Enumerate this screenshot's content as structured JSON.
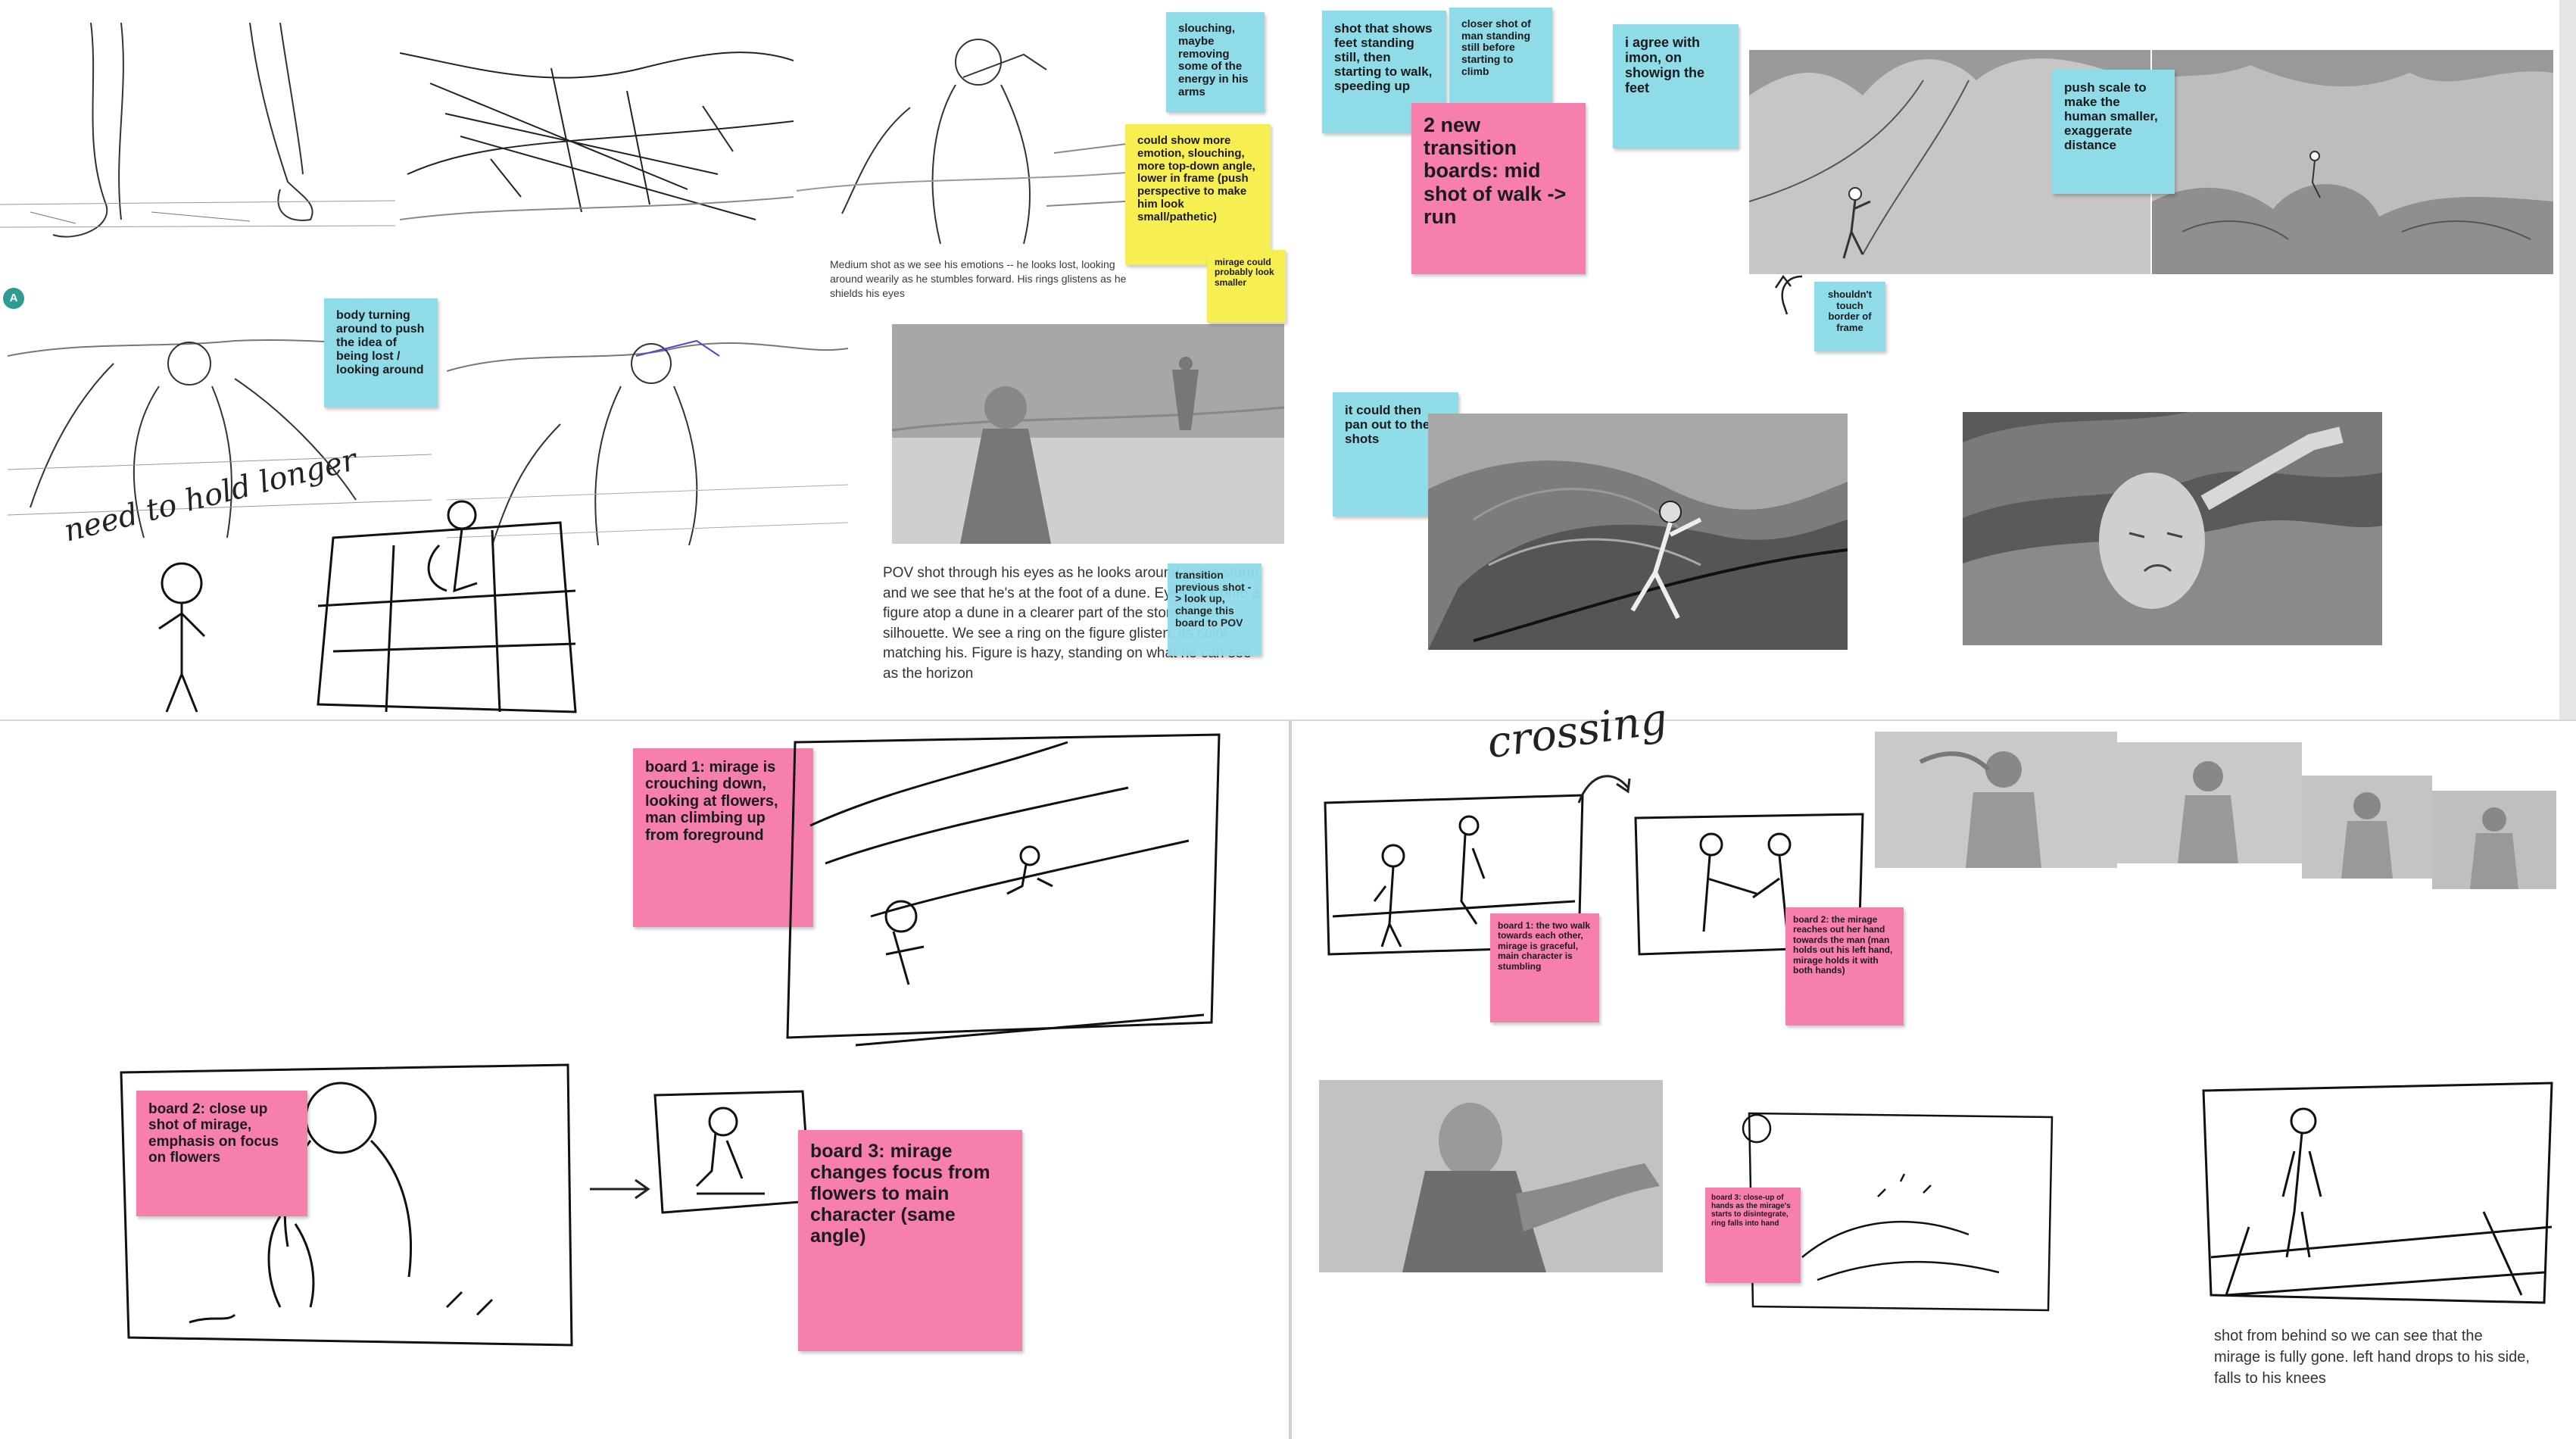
{
  "board": {
    "comment_marker": "A"
  },
  "notes": {
    "slouching": "slouching, maybe removing some of the energy in his arms",
    "more_emotion": "could show more emotion, slouching, more top-down angle, lower in frame (push perspective to make him look small/pathetic)",
    "mirage_smaller": "mirage could probably look smaller",
    "body_turning": "body turning around to push the idea of being lost / looking around",
    "transition": "transition previous shot -> look up, change this board to POV",
    "feet_shot": "shot that shows feet standing still, then starting to walk, speeding up",
    "closer_shot": "closer shot of man standing still before starting to climb",
    "two_new": "2 new transition boards: mid shot of walk -> run",
    "agree_imon": "i agree with imon, on showign the feet",
    "push_scale": "push scale to make the human smaller, exaggerate distance",
    "border": "shouldn't touch border of frame",
    "pan_out": "it could then pan out to these shots",
    "board1_mirage": "board 1: mirage is crouching down, looking at flowers, man climbing up from foreground",
    "board2_closeup": "board 2: close up shot of mirage, emphasis on focus on flowers",
    "board3_focus": "board 3: mirage changes focus from flowers to main character (same angle)",
    "board1_walk": "board 1: the two walk towards each other, mirage is graceful, main character is stumbling",
    "board2_reach": "board 2: the mirage reaches out her hand towards the man (man holds out his left hand, mirage holds it with both hands)",
    "board3_hands": "board 3: close-up of hands as the mirage's starts to disintegrate, ring falls into hand"
  },
  "captions": {
    "medium_shot": "Medium shot as we see his emotions -- he looks lost, looking around wearily as he stumbles forward. His rings glistens as he shields his eyes",
    "pov_shot": "POV shot through his eyes as he looks around in the storm, and we see that he's at the foot of a dune. Eyes lock onto a figure atop a dune in a clearer part of the storm -- a silhouette. We see a ring on the figure glisten, its color matching his. Figure is hazy, standing on what he can see as the horizon",
    "from_behind": "shot from behind so we can see that the mirage is fully gone. left hand drops to his side, falls to his knees"
  },
  "handwriting": {
    "need_hold": "need to hold longer",
    "crossing": "crossing"
  },
  "colors": {
    "cyan_note": "#8fdbe8",
    "yellow_note": "#f7ee52",
    "pink_note": "#f77fae",
    "marker": "#2e9c92"
  }
}
